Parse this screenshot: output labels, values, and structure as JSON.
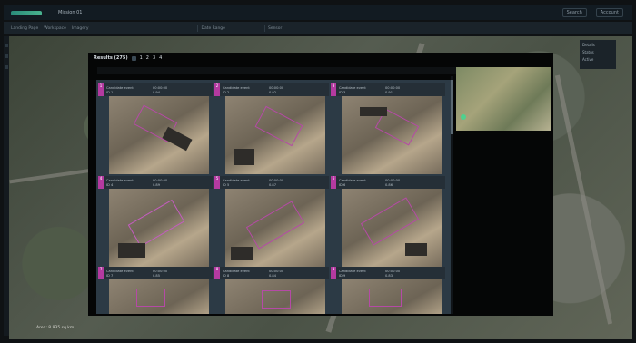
{
  "app": {
    "title": "Mission 01",
    "top_right": [
      "Search",
      "Account"
    ]
  },
  "subbar": {
    "crumbs": [
      "Landing Page",
      "Workspace",
      "Imagery"
    ],
    "filters": [
      "Date Range",
      "Sensor"
    ]
  },
  "map": {
    "scale": "Area: 8.935 sq km"
  },
  "modal": {
    "title": "Results (275)",
    "controls": [
      "1",
      "2",
      "3",
      "4"
    ],
    "cards": [
      {
        "pin": "1",
        "col1": [
          "Candidate event",
          "ID 1"
        ],
        "col2": [
          "00:00:00",
          "0.94"
        ]
      },
      {
        "pin": "2",
        "col1": [
          "Candidate event",
          "ID 2"
        ],
        "col2": [
          "00:00:00",
          "0.92"
        ]
      },
      {
        "pin": "3",
        "col1": [
          "Candidate event",
          "ID 3"
        ],
        "col2": [
          "00:00:00",
          "0.91"
        ]
      },
      {
        "pin": "4",
        "col1": [
          "Candidate event",
          "ID 4"
        ],
        "col2": [
          "00:00:00",
          "0.89"
        ]
      },
      {
        "pin": "5",
        "col1": [
          "Candidate event",
          "ID 5"
        ],
        "col2": [
          "00:00:00",
          "0.87"
        ]
      },
      {
        "pin": "6",
        "col1": [
          "Candidate event",
          "ID 6"
        ],
        "col2": [
          "00:00:00",
          "0.86"
        ]
      },
      {
        "pin": "7",
        "col1": [
          "Candidate event",
          "ID 7"
        ],
        "col2": [
          "00:00:00",
          "0.85"
        ]
      },
      {
        "pin": "8",
        "col1": [
          "Candidate event",
          "ID 8"
        ],
        "col2": [
          "00:00:00",
          "0.84"
        ]
      },
      {
        "pin": "9",
        "col1": [
          "Candidate event",
          "ID 9"
        ],
        "col2": [
          "00:00:00",
          "0.83"
        ]
      }
    ]
  },
  "side_panel": {
    "lines": [
      "Details",
      "Status",
      "Active"
    ]
  },
  "colors": {
    "accent": "#b43aa0",
    "highlight": "#4fd08e"
  }
}
